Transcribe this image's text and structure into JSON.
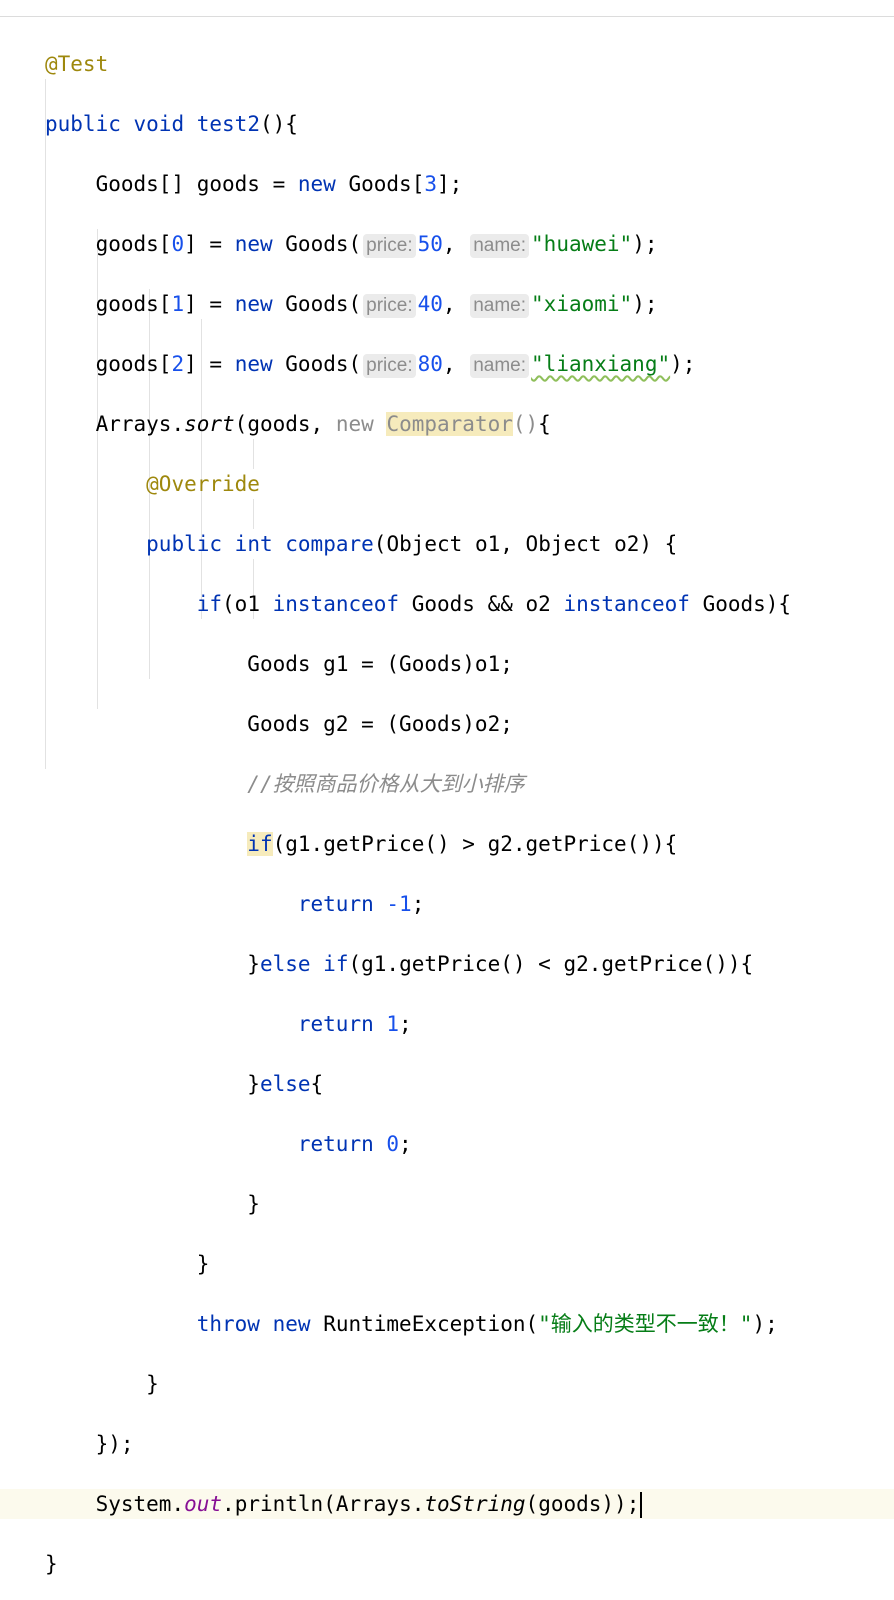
{
  "editor": {
    "language": "Java",
    "code": {
      "annotation_test": "@Test",
      "kw_public": "public",
      "kw_void": "void",
      "kw_new": "new",
      "kw_int": "int",
      "kw_if": "if",
      "kw_else": "else",
      "kw_return": "return",
      "kw_instanceof": "instanceof",
      "kw_throw": "throw",
      "annotation_override": "@Override",
      "method_test2": "test2",
      "method_compare": "compare",
      "type_goods": "Goods",
      "var_goods": "goods",
      "hint_price": "price:",
      "hint_name": "name:",
      "items": [
        {
          "index": "0",
          "price": "50",
          "name": "\"huawei\""
        },
        {
          "index": "1",
          "price": "40",
          "name": "\"xiaomi\""
        },
        {
          "index": "2",
          "price": "80",
          "name": "\"lianxiang\""
        }
      ],
      "array_size": "3",
      "arrays_class": "Arrays",
      "sort_method": "sort",
      "comparator_type": "Comparator",
      "object_type": "Object",
      "param_o1": "o1",
      "param_o2": "o2",
      "var_g1": "g1",
      "var_g2": "g2",
      "comment": "//按照商品价格从大到小排序",
      "get_price": "getPrice",
      "neg_one": "-1",
      "one": "1",
      "zero": "0",
      "exception_type": "RuntimeException",
      "exception_msg": "\"输入的类型不一致！\"",
      "system_class": "System",
      "out_field": "out",
      "println": "println",
      "to_string": "toString"
    }
  }
}
